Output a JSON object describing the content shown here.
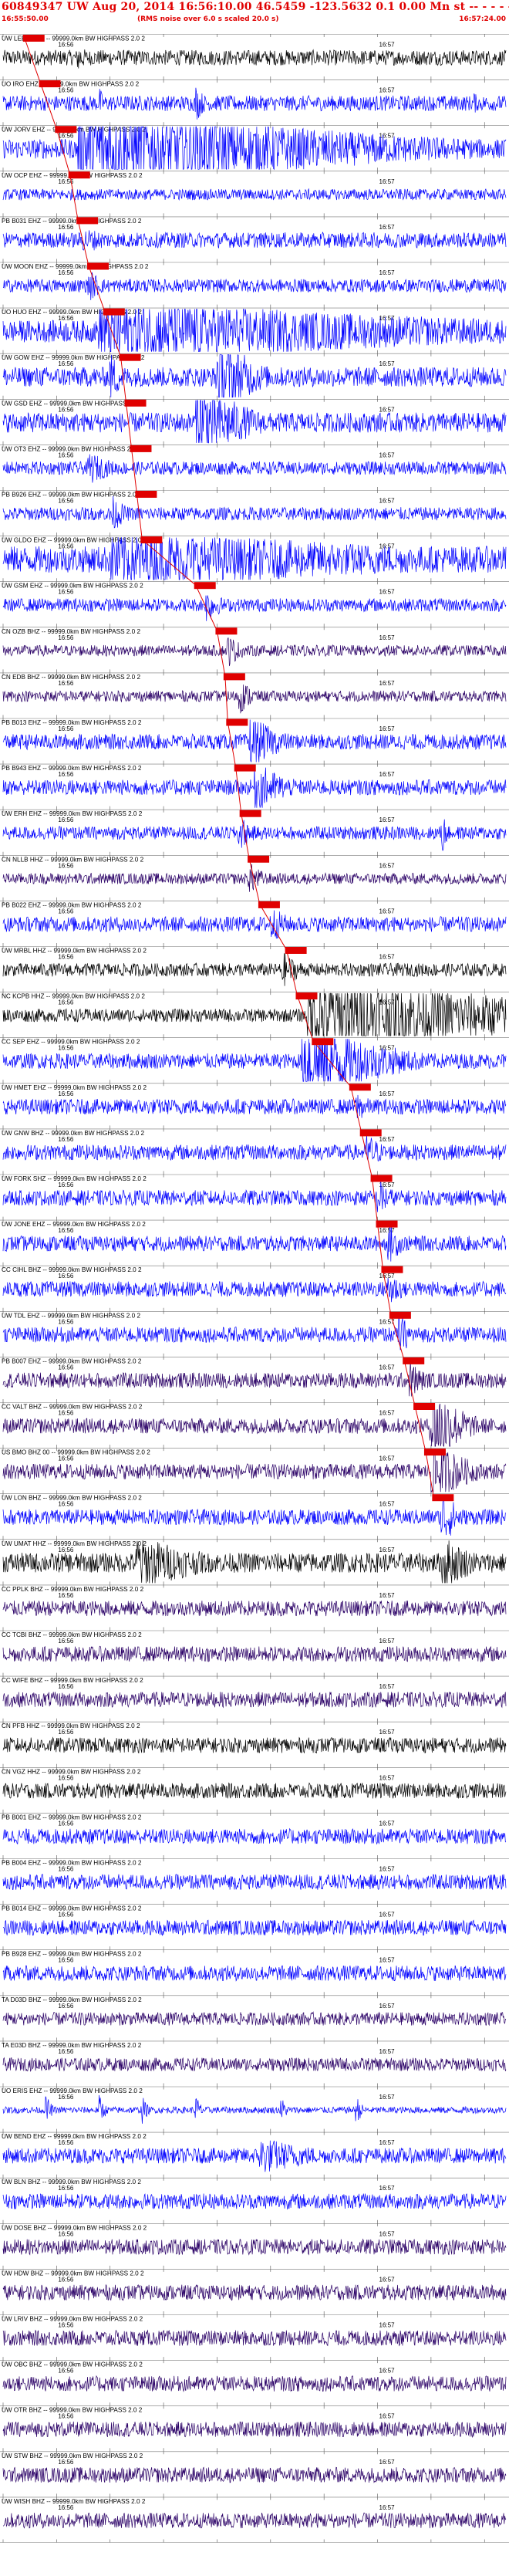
{
  "header": {
    "title": "60849347 UW Aug 20, 2014 16:56:10.00   46.5459 -123.5632  0.1 0.00 Mn st -- - - -  -1",
    "start_time": "16:55:50.00",
    "note": "(RMS noise over 6.0 s scaled 20.0 s)",
    "end_time": "16:57:24.00"
  },
  "chart_data": {
    "type": "line",
    "description": "Seismogram record section, traces sorted by distance, red markers at picked arrival times",
    "time_range_s": [
      0,
      94
    ],
    "time_axis_labels": [
      "16:56",
      "16:57"
    ],
    "time_label_seconds": [
      10,
      70
    ],
    "tick_interval_s": 10,
    "filter_suffix": " -- 99999.0km BW HIGHPASS  2.0  2",
    "colors": {
      "red": "#e00000",
      "blue": "#0000ff",
      "black": "#000000",
      "purple": "#2a0066",
      "separator": "#777777"
    },
    "traces": [
      {
        "label": "UW LEBA HHZ",
        "color": "black",
        "pick": 4.0,
        "amp": 0.35,
        "events": [
          [
            14,
            0.9,
            1.5
          ]
        ]
      },
      {
        "label": "UO IRO EHZ",
        "color": "blue",
        "pick": 7.0,
        "amp": 0.35,
        "events": [
          [
            18,
            0.8,
            1
          ],
          [
            36,
            0.9,
            2
          ],
          [
            66,
            0.5,
            1
          ],
          [
            88,
            0.6,
            1
          ]
        ]
      },
      {
        "label": "UW JORV EHZ",
        "color": "blue",
        "pick": 10.0,
        "amp": 0.45,
        "events": [
          [
            14,
            2.4,
            45
          ]
        ]
      },
      {
        "label": "UW OCP EHZ",
        "color": "blue",
        "pick": 12.5,
        "amp": 0.25,
        "events": []
      },
      {
        "label": "PB B031 EHZ",
        "color": "blue",
        "pick": 14.0,
        "amp": 0.35,
        "events": [
          [
            15,
            0.6,
            8
          ]
        ]
      },
      {
        "label": "UW MOON EHZ",
        "color": "blue",
        "pick": 16.0,
        "amp": 0.3,
        "events": [
          [
            16,
            0.8,
            3
          ]
        ]
      },
      {
        "label": "UO HUO EHZ",
        "color": "blue",
        "pick": 19.0,
        "amp": 0.5,
        "events": [
          [
            18,
            1.6,
            70
          ]
        ]
      },
      {
        "label": "UW GOW EHZ",
        "color": "blue",
        "pick": 22.0,
        "amp": 0.45,
        "events": [
          [
            20,
            1.2,
            3
          ],
          [
            40,
            2.4,
            6
          ]
        ]
      },
      {
        "label": "UW GSD EHZ",
        "color": "blue",
        "pick": 23.0,
        "amp": 0.45,
        "events": [
          [
            36,
            2.4,
            8
          ]
        ]
      },
      {
        "label": "UW OT3 EHZ",
        "color": "blue",
        "pick": 24.0,
        "amp": 0.3,
        "events": [
          [
            16,
            0.8,
            5
          ]
        ]
      },
      {
        "label": "PB B926 EHZ",
        "color": "blue",
        "pick": 25.0,
        "amp": 0.3,
        "events": [
          [
            20,
            1.0,
            3
          ]
        ]
      },
      {
        "label": "UW GLDO EHZ",
        "color": "blue",
        "pick": 26.0,
        "amp": 0.6,
        "events": [
          [
            20,
            1.4,
            70
          ]
        ]
      },
      {
        "label": "UW GSM EHZ",
        "color": "blue",
        "pick": 36.0,
        "amp": 0.3,
        "events": [
          [
            38,
            0.9,
            3
          ]
        ]
      },
      {
        "label": "CN OZB BHZ",
        "color": "purple",
        "pick": 40.0,
        "amp": 0.25,
        "events": [
          [
            42,
            0.8,
            3
          ]
        ]
      },
      {
        "label": "CN EDB BHZ",
        "color": "purple",
        "pick": 41.5,
        "amp": 0.25,
        "events": [
          [
            44,
            0.9,
            3
          ]
        ]
      },
      {
        "label": "PB B013 EHZ",
        "color": "blue",
        "pick": 42.0,
        "amp": 0.35,
        "events": [
          [
            46,
            1.3,
            6
          ]
        ]
      },
      {
        "label": "PB B943 EHZ",
        "color": "blue",
        "pick": 43.5,
        "amp": 0.35,
        "events": [
          [
            47,
            1.3,
            6
          ]
        ]
      },
      {
        "label": "UW ERH EHZ",
        "color": "blue",
        "pick": 44.5,
        "amp": 0.3,
        "events": [
          [
            44,
            0.9,
            3
          ],
          [
            82,
            1.2,
            1
          ]
        ]
      },
      {
        "label": "CN NLLB HHZ",
        "color": "purple",
        "pick": 46.0,
        "amp": 0.25,
        "events": [
          [
            46,
            0.8,
            3
          ]
        ]
      },
      {
        "label": "PB B022 EHZ",
        "color": "blue",
        "pick": 48.0,
        "amp": 0.35,
        "events": [
          [
            50,
            0.9,
            4
          ]
        ]
      },
      {
        "label": "UW MRBL HHZ",
        "color": "black",
        "pick": 53.0,
        "amp": 0.3,
        "events": [
          [
            52,
            0.9,
            4
          ]
        ]
      },
      {
        "label": "NC KCPB HHZ",
        "color": "black",
        "pick": 55.0,
        "amp": 0.3,
        "events": [
          [
            57,
            2.2,
            40
          ]
        ]
      },
      {
        "label": "CC SEP EHZ",
        "color": "blue",
        "pick": 58.0,
        "amp": 0.35,
        "events": [
          [
            56,
            2.6,
            12
          ]
        ]
      },
      {
        "label": "UW HMET EHZ",
        "color": "blue",
        "pick": 65.0,
        "amp": 0.35,
        "events": [
          [
            66,
            0.8,
            3
          ]
        ]
      },
      {
        "label": "UW GNW BHZ",
        "color": "blue",
        "pick": 67.0,
        "amp": 0.35,
        "events": [
          [
            68,
            1.0,
            3
          ]
        ]
      },
      {
        "label": "UW FORK SHZ",
        "color": "blue",
        "pick": 69.0,
        "amp": 0.35,
        "events": [
          [
            70,
            1.0,
            3
          ]
        ]
      },
      {
        "label": "UW JONE EHZ",
        "color": "blue",
        "pick": 70.0,
        "amp": 0.35,
        "events": [
          [
            72,
            1.0,
            3
          ]
        ]
      },
      {
        "label": "CC CIHL BHZ",
        "color": "blue",
        "pick": 71.0,
        "amp": 0.35,
        "events": [
          [
            72,
            1.0,
            3
          ]
        ]
      },
      {
        "label": "UW TDL EHZ",
        "color": "blue",
        "pick": 72.5,
        "amp": 0.35,
        "events": [
          [
            74,
            1.0,
            3
          ]
        ]
      },
      {
        "label": "PB B007 EHZ",
        "color": "purple",
        "pick": 75.0,
        "amp": 0.35,
        "events": [
          [
            76,
            1.0,
            3
          ]
        ]
      },
      {
        "label": "CC VALT BHZ",
        "color": "purple",
        "pick": 77.0,
        "amp": 0.35,
        "events": [
          [
            80,
            2.4,
            5
          ]
        ]
      },
      {
        "label": "US BMO BHZ 00",
        "color": "purple",
        "pick": 79.0,
        "amp": 0.35,
        "events": [
          [
            80,
            1.8,
            6
          ]
        ]
      },
      {
        "label": "UW LON BHZ",
        "color": "blue",
        "pick": 80.5,
        "amp": 0.35,
        "events": [
          [
            82,
            1.5,
            3
          ]
        ]
      },
      {
        "label": "UW UMAT HHZ",
        "color": "black",
        "pick": null,
        "amp": 0.45,
        "events": [
          [
            25,
            1.4,
            12
          ],
          [
            82,
            1.4,
            6
          ]
        ]
      },
      {
        "label": "CC PPLK BHZ",
        "color": "purple",
        "pick": null,
        "amp": 0.35,
        "events": []
      },
      {
        "label": "CC TCBI BHZ",
        "color": "purple",
        "pick": null,
        "amp": 0.35,
        "events": []
      },
      {
        "label": "CC WIFE BHZ",
        "color": "purple",
        "pick": null,
        "amp": 0.35,
        "events": []
      },
      {
        "label": "CN PFB HHZ",
        "color": "black",
        "pick": null,
        "amp": 0.35,
        "events": []
      },
      {
        "label": "CN VGZ HHZ",
        "color": "black",
        "pick": null,
        "amp": 0.35,
        "events": []
      },
      {
        "label": "PB B001 EHZ",
        "color": "blue",
        "pick": null,
        "amp": 0.35,
        "events": []
      },
      {
        "label": "PB B004 EHZ",
        "color": "blue",
        "pick": null,
        "amp": 0.35,
        "events": []
      },
      {
        "label": "PB B014 EHZ",
        "color": "blue",
        "pick": null,
        "amp": 0.35,
        "events": []
      },
      {
        "label": "PB B928 EHZ",
        "color": "blue",
        "pick": null,
        "amp": 0.35,
        "events": []
      },
      {
        "label": "TA D03D BHZ",
        "color": "purple",
        "pick": null,
        "amp": 0.3,
        "events": []
      },
      {
        "label": "TA E03D BHZ",
        "color": "purple",
        "pick": null,
        "amp": 0.3,
        "events": []
      },
      {
        "label": "UO ERIS EHZ",
        "color": "blue",
        "pick": null,
        "amp": 0.15,
        "events": [
          [
            8,
            0.8,
            1
          ],
          [
            18,
            0.8,
            1
          ],
          [
            26,
            0.7,
            1
          ],
          [
            36,
            0.8,
            1
          ],
          [
            52,
            0.7,
            1
          ],
          [
            66,
            0.8,
            1
          ]
        ]
      },
      {
        "label": "UW BEND EHZ",
        "color": "blue",
        "pick": null,
        "amp": 0.35,
        "events": [
          [
            48,
            0.9,
            12
          ]
        ]
      },
      {
        "label": "UW BLN BHZ",
        "color": "blue",
        "pick": null,
        "amp": 0.35,
        "events": []
      },
      {
        "label": "UW DOSE BHZ",
        "color": "purple",
        "pick": null,
        "amp": 0.35,
        "events": []
      },
      {
        "label": "UW HDW BHZ",
        "color": "purple",
        "pick": null,
        "amp": 0.35,
        "events": []
      },
      {
        "label": "UW LRIV BHZ",
        "color": "purple",
        "pick": null,
        "amp": 0.35,
        "events": []
      },
      {
        "label": "UW OBC BHZ",
        "color": "purple",
        "pick": null,
        "amp": 0.35,
        "events": []
      },
      {
        "label": "UW OTR BHZ",
        "color": "purple",
        "pick": null,
        "amp": 0.35,
        "events": []
      },
      {
        "label": "UW STW BHZ",
        "color": "purple",
        "pick": null,
        "amp": 0.35,
        "events": []
      },
      {
        "label": "UW WISH BHZ",
        "color": "purple",
        "pick": null,
        "amp": 0.35,
        "events": []
      }
    ]
  }
}
